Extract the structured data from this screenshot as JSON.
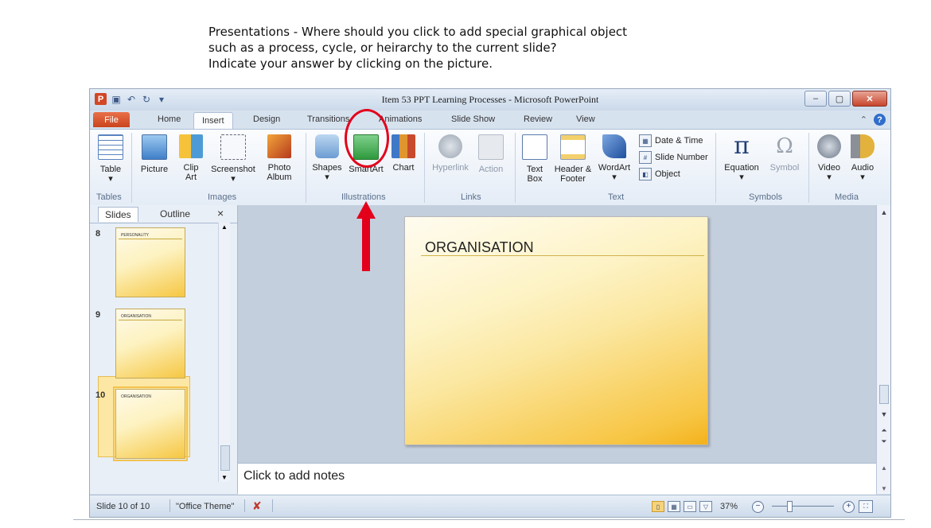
{
  "question": {
    "line1": "Presentations - Where should you click to add special graphical object",
    "line2": "such as a process, cycle, or heirarchy to the current slide?",
    "line3": "Indicate your answer by clicking on the picture."
  },
  "window": {
    "title": "Item 53 PPT Learning Processes - Microsoft PowerPoint",
    "app_icon": "P",
    "minimize_icon": "minimize-icon",
    "maximize_icon": "maximize-icon",
    "close_icon": "close-icon"
  },
  "tabs": [
    "File",
    "Home",
    "Insert",
    "Design",
    "Transitions",
    "Animations",
    "Slide Show",
    "Review",
    "View"
  ],
  "active_tab": "Insert",
  "ribbon": {
    "table": "Table",
    "picture": "Picture",
    "clip_art": "Clip Art",
    "screenshot": "Screenshot",
    "photo_album": "Photo Album",
    "shapes": "Shapes",
    "smartart": "SmartArt",
    "chart": "Chart",
    "hyperlink": "Hyperlink",
    "action": "Action",
    "text_box": "Text Box",
    "header_footer": "Header & Footer",
    "wordart": "WordArt",
    "date_time": "Date & Time",
    "slide_number": "Slide Number",
    "object": "Object",
    "equation": "Equation",
    "symbol": "Symbol",
    "video": "Video",
    "audio": "Audio",
    "groups": {
      "tables": "Tables",
      "images": "Images",
      "illustrations": "Illustrations",
      "links": "Links",
      "text": "Text",
      "symbols": "Symbols",
      "media": "Media"
    }
  },
  "pane": {
    "slides_tab": "Slides",
    "outline_tab": "Outline",
    "close": "×",
    "thumbnails": [
      {
        "num": "8",
        "title": "PERSONALITY"
      },
      {
        "num": "9",
        "title": "ORGANISATION"
      },
      {
        "num": "10",
        "title": "ORGANISATION"
      }
    ]
  },
  "slide": {
    "title": "ORGANISATION"
  },
  "notes": {
    "placeholder": "Click to add notes"
  },
  "status": {
    "slide_count": "Slide 10 of 10",
    "theme": "\"Office Theme\"",
    "zoom": "37%",
    "zoom_minus": "−",
    "zoom_plus": "+"
  },
  "colors": {
    "annotation": "#e3001b",
    "file_tab": "#d24726",
    "slide_gold": "#f4b11c"
  }
}
